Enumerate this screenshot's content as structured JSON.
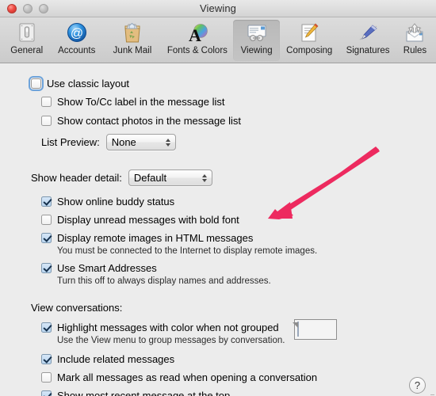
{
  "window": {
    "title": "Viewing",
    "traffic_lights": [
      "close-button",
      "minimize-button",
      "zoom-button"
    ]
  },
  "toolbar": {
    "items": [
      {
        "label": "General",
        "icon": "general-icon",
        "selected": false
      },
      {
        "label": "Accounts",
        "icon": "accounts-at-icon",
        "selected": false
      },
      {
        "label": "Junk Mail",
        "icon": "junk-mail-icon",
        "selected": false
      },
      {
        "label": "Fonts & Colors",
        "icon": "fonts-colors-icon",
        "selected": false
      },
      {
        "label": "Viewing",
        "icon": "viewing-icon",
        "selected": true
      },
      {
        "label": "Composing",
        "icon": "composing-icon",
        "selected": false
      },
      {
        "label": "Signatures",
        "icon": "signatures-icon",
        "selected": false
      },
      {
        "label": "Rules",
        "icon": "rules-icon",
        "selected": false
      }
    ]
  },
  "main": {
    "classic_layout": {
      "label": "Use classic layout",
      "checked": false,
      "focused": true
    },
    "show_tocc": {
      "label": "Show To/Cc label in the message list",
      "checked": false
    },
    "show_contact_photos": {
      "label": "Show contact photos in the message list",
      "checked": false
    },
    "list_preview": {
      "label": "List Preview:",
      "value": "None"
    },
    "header_detail": {
      "label": "Show header detail:",
      "value": "Default"
    },
    "buddy_status": {
      "label": "Show online buddy status",
      "checked": true
    },
    "unread_bold": {
      "label": "Display unread messages with bold font",
      "checked": false
    },
    "remote_images": {
      "label": "Display remote images in HTML messages",
      "sublabel": "You must be connected to the Internet to display remote images.",
      "checked": true
    },
    "smart_addresses": {
      "label": "Use Smart Addresses",
      "sublabel": "Turn this off to always display names and addresses.",
      "checked": true
    },
    "conversations_heading": "View conversations:",
    "highlight_color": {
      "label": "Highlight messages with color when not grouped",
      "sublabel": "Use the View menu to group messages by conversation.",
      "checked": true,
      "swatch_color": "#c5d8ef"
    },
    "include_related": {
      "label": "Include related messages",
      "checked": true
    },
    "mark_read": {
      "label": "Mark all messages as read when opening a conversation",
      "checked": false
    },
    "recent_top": {
      "label": "Show most recent message at the top",
      "checked": true
    },
    "help_label": "?"
  },
  "annotation": {
    "arrow_color": "#ED2A5F",
    "points_at": "Display remote images in HTML messages"
  }
}
